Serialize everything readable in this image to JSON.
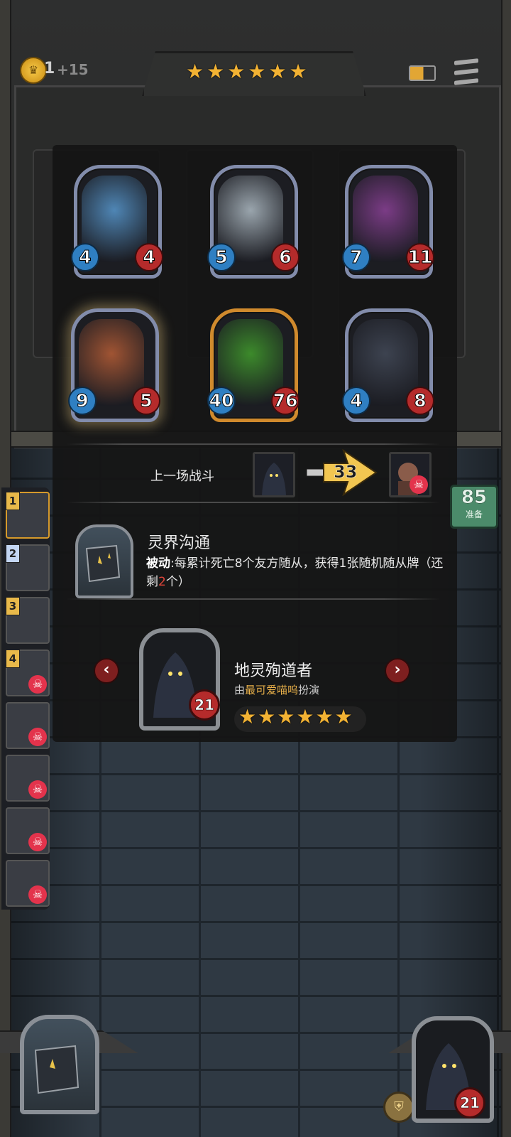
{
  "top_bar": {
    "gold": "1",
    "gold_income": "+15",
    "tavern_stars": 6
  },
  "minions": [
    {
      "attack": "4",
      "health": "4",
      "art_color": "#4f86b5",
      "golden": false,
      "highlight": false
    },
    {
      "attack": "5",
      "health": "6",
      "art_color": "#9aa5ad",
      "golden": false,
      "highlight": false
    },
    {
      "attack": "7",
      "health": "11",
      "art_color": "#7b3c86",
      "golden": false,
      "highlight": false
    },
    {
      "attack": "9",
      "health": "5",
      "art_color": "#a05433",
      "golden": false,
      "highlight": true
    },
    {
      "attack": "40",
      "health": "76",
      "art_color": "#3c8a2b",
      "golden": true,
      "highlight": false
    },
    {
      "attack": "4",
      "health": "8",
      "art_color": "#3d4350",
      "golden": false,
      "highlight": false
    }
  ],
  "last_battle": {
    "label": "上一场战斗",
    "damage": "33"
  },
  "hero_power": {
    "title": "灵界沟通",
    "desc_prefix": "被动",
    "desc_main": ":每累计死亡8个友方随从，获得1张随机随从牌（还剩",
    "desc_remaining": "2",
    "desc_suffix": "个）"
  },
  "hero": {
    "name": "地灵殉道者",
    "by_prefix": "由",
    "by_highlight": "最可爱喵呜",
    "by_suffix": "扮演",
    "health": "21",
    "stars": 6
  },
  "side_list": [
    {
      "rank": "1",
      "dead": false
    },
    {
      "rank": "2",
      "dead": false
    },
    {
      "rank": "3",
      "dead": false
    },
    {
      "rank": "4",
      "dead": true
    },
    {
      "rank": "",
      "dead": true
    },
    {
      "rank": "",
      "dead": true
    },
    {
      "rank": "",
      "dead": true
    },
    {
      "rank": "",
      "dead": true
    }
  ],
  "counter": {
    "value": "85",
    "label": "准备"
  },
  "bottom": {
    "hero_health": "21"
  },
  "icons": {
    "skull": "☠",
    "star": "★",
    "arrow_left": "‹",
    "arrow_right": "›",
    "coin": "crown-coin-icon",
    "helm": "helmet-icon"
  }
}
